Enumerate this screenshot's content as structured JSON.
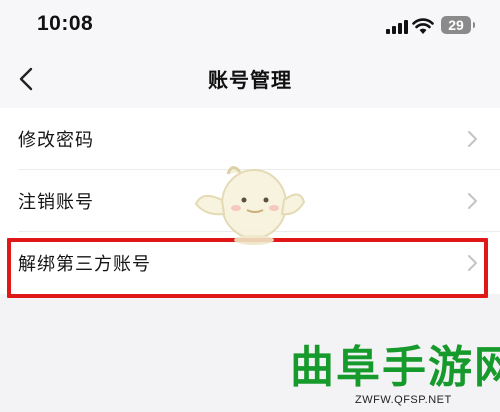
{
  "status_bar": {
    "time": "10:08",
    "battery_level": "29",
    "icons": [
      "cellular-signal-icon",
      "wifi-icon",
      "battery-icon"
    ]
  },
  "nav_bar": {
    "title": "账号管理",
    "back_icon": "chevron-left-icon"
  },
  "settings_list": {
    "items": [
      {
        "label": "修改密码",
        "icon": "chevron-right-icon"
      },
      {
        "label": "注销账号",
        "icon": "chevron-right-icon"
      },
      {
        "label": "解绑第三方账号",
        "icon": "chevron-right-icon",
        "highlighted": true
      }
    ]
  },
  "watermark": {
    "text": "曲阜手游网",
    "url": "ZWFW.QFSP.NET"
  },
  "colors": {
    "background": "#f3f3f6",
    "highlight_border": "#e01818",
    "watermark_green": "#179a2c",
    "chevron": "#c4c4c4"
  }
}
